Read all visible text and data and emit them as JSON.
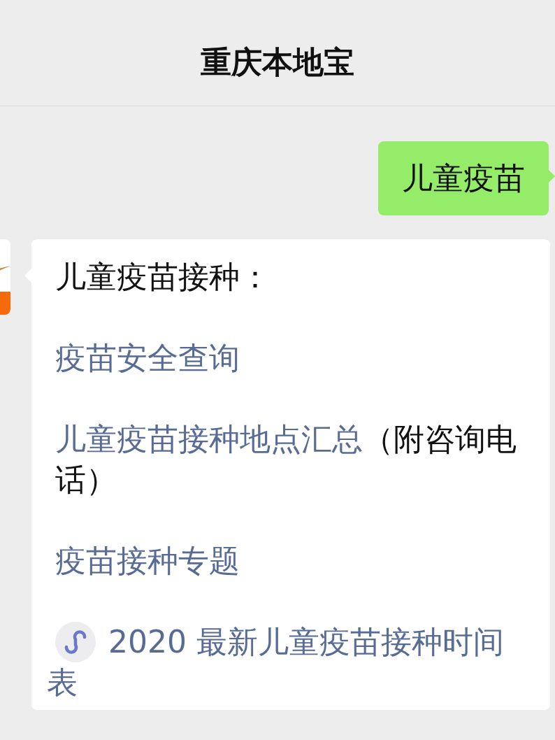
{
  "header": {
    "title": "重庆本地宝"
  },
  "messages": [
    {
      "kind": "sent",
      "text": "儿童疫苗"
    },
    {
      "kind": "received",
      "blocks": [
        {
          "kind": "plain",
          "text": "儿童疫苗接种："
        },
        {
          "kind": "link",
          "text": "疫苗安全查询"
        },
        {
          "kind": "link",
          "text": "儿童疫苗接种地点汇总",
          "suffix": "（附咨询电话）"
        },
        {
          "kind": "link",
          "text": "疫苗接种专题"
        },
        {
          "kind": "miniprogram",
          "text": "2020 最新儿童疫苗接种时间表"
        }
      ]
    }
  ]
}
